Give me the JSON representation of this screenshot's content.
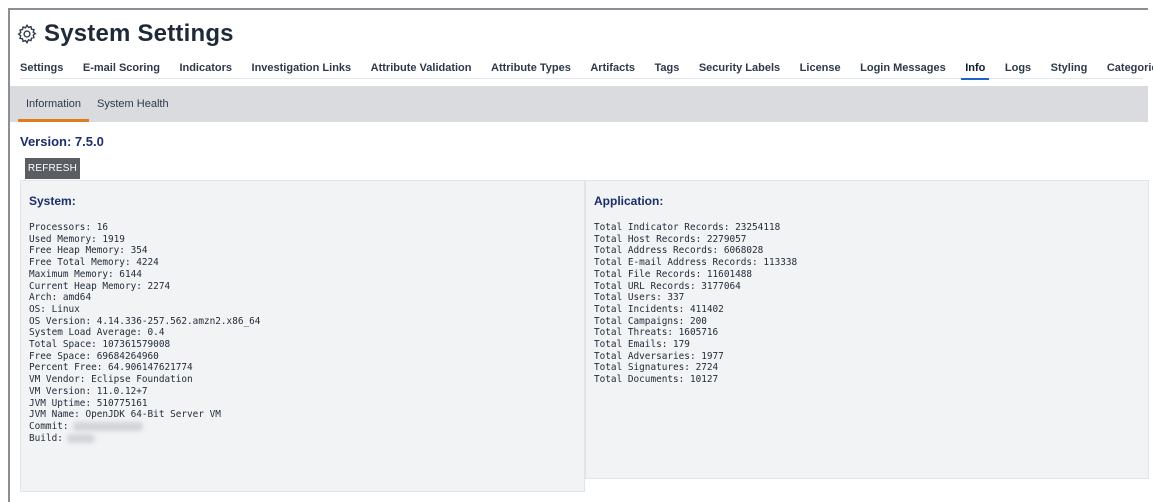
{
  "header": {
    "title": "System Settings",
    "icon": "gear-icon"
  },
  "top_tabs": [
    {
      "label": "Settings"
    },
    {
      "label": "E-mail Scoring"
    },
    {
      "label": "Indicators"
    },
    {
      "label": "Investigation Links"
    },
    {
      "label": "Attribute Validation"
    },
    {
      "label": "Attribute Types"
    },
    {
      "label": "Artifacts"
    },
    {
      "label": "Tags"
    },
    {
      "label": "Security Labels"
    },
    {
      "label": "License"
    },
    {
      "label": "Login Messages"
    },
    {
      "label": "Info",
      "active": true
    },
    {
      "label": "Logs"
    },
    {
      "label": "Styling"
    },
    {
      "label": "Categories"
    }
  ],
  "sub_tabs": [
    {
      "label": "Information",
      "active": true
    },
    {
      "label": "System Health"
    }
  ],
  "version": "Version: 7.5.0",
  "refresh_label": "REFRESH",
  "system": {
    "heading": "System:",
    "lines": [
      "Processors: 16",
      "Used Memory: 1919",
      "Free Heap Memory: 354",
      "Free Total Memory: 4224",
      "Maximum Memory: 6144",
      "Current Heap Memory: 2274",
      "Arch: amd64",
      "OS: Linux",
      "OS Version: 4.14.336-257.562.amzn2.x86_64",
      "System Load Average: 0.4",
      "Total Space: 107361579008",
      "Free Space: 69684264960",
      "Percent Free: 64.906147621774",
      "VM Vendor: Eclipse Foundation",
      "VM Version: 11.0.12+7",
      "JVM Uptime: 510775161",
      "JVM Name: OpenJDK 64-Bit Server VM",
      "Commit:",
      "Build:"
    ]
  },
  "application": {
    "heading": "Application:",
    "lines": [
      "Total Indicator Records: 23254118",
      "Total Host Records: 2279057",
      "Total Address Records: 6068028",
      "Total E-mail Address Records: 113338",
      "Total File Records: 11601488",
      "Total URL Records: 3177064",
      "Total Users: 337",
      "Total Incidents: 411402",
      "Total Campaigns: 200",
      "Total Threats: 1605716",
      "Total Emails: 179",
      "Total Adversaries: 1977",
      "Total Signatures: 2724",
      "Total Documents: 10127"
    ]
  },
  "colors": {
    "active_tab_underline": "#1e63c8",
    "sub_tab_underline": "#e07b1e",
    "heading": "#1a2f6b",
    "refresh_bg": "#5a5e63"
  }
}
